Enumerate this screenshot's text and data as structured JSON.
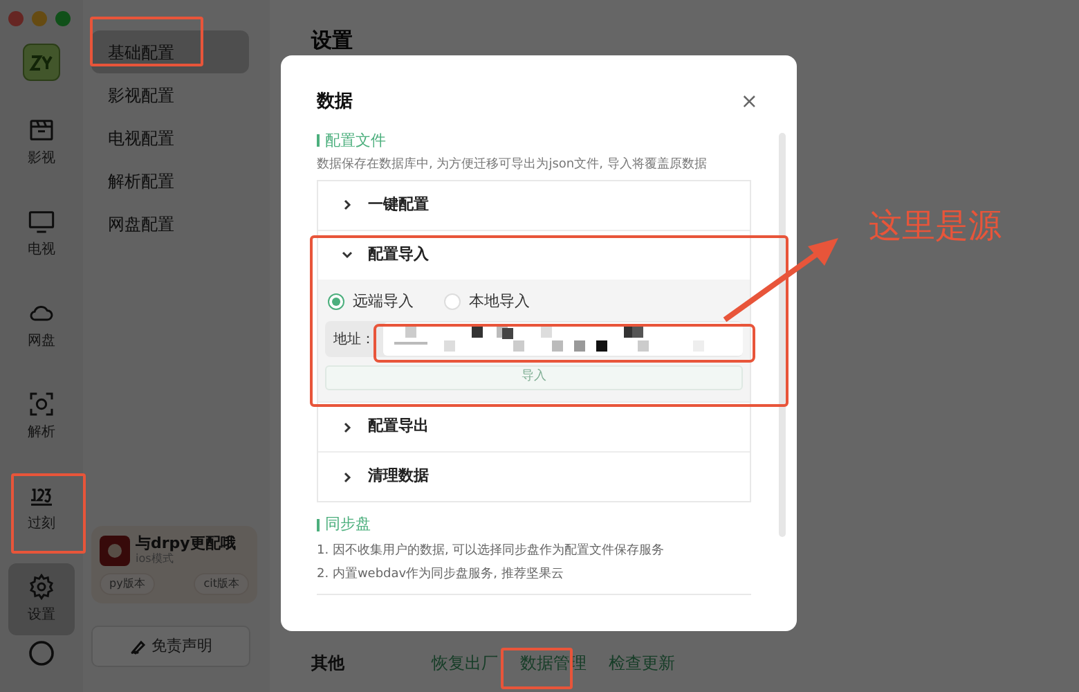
{
  "nav": {
    "items": [
      {
        "label": "影视",
        "selected": false
      },
      {
        "label": "电视",
        "selected": false
      },
      {
        "label": "网盘",
        "selected": false
      },
      {
        "label": "解析",
        "selected": false
      },
      {
        "label": "过刻",
        "selected": false
      },
      {
        "label": "设置",
        "selected": true
      }
    ]
  },
  "subnav": {
    "items": [
      {
        "label": "基础配置",
        "selected": true
      },
      {
        "label": "影视配置",
        "selected": false
      },
      {
        "label": "电视配置",
        "selected": false
      },
      {
        "label": "解析配置",
        "selected": false
      },
      {
        "label": "网盘配置",
        "selected": false
      }
    ]
  },
  "promo": {
    "title": "与drpy更配哦",
    "subtitle": "ios模式",
    "buttons": [
      "py版本",
      "cit版本"
    ]
  },
  "disclaimer_button": "免责声明",
  "page": {
    "title": "设置",
    "other": {
      "label": "其他",
      "links": [
        "恢复出厂",
        "数据管理",
        "检查更新"
      ]
    }
  },
  "dialog": {
    "title": "数据",
    "close": "×",
    "config": {
      "heading": "配置文件",
      "description": "数据保存在数据库中, 为方便迁移可导出为json文件, 导入将覆盖原数据",
      "items": [
        {
          "label": "一键配置",
          "expanded": false
        },
        {
          "label": "配置导入",
          "expanded": true
        },
        {
          "label": "配置导出",
          "expanded": false
        },
        {
          "label": "清理数据",
          "expanded": false
        }
      ],
      "import": {
        "radios": [
          {
            "label": "远端导入",
            "selected": true
          },
          {
            "label": "本地导入",
            "selected": false
          }
        ],
        "address_label": "地址：",
        "button": "导入",
        "button_disabled": true
      }
    },
    "sync": {
      "heading": "同步盘",
      "notes": [
        "1. 因不收集用户的数据, 可以选择同步盘作为配置文件保存服务",
        "2. 内置webdav作为同步盘服务, 推荐坚果云"
      ]
    }
  },
  "annotation": {
    "text": "这里是源"
  }
}
